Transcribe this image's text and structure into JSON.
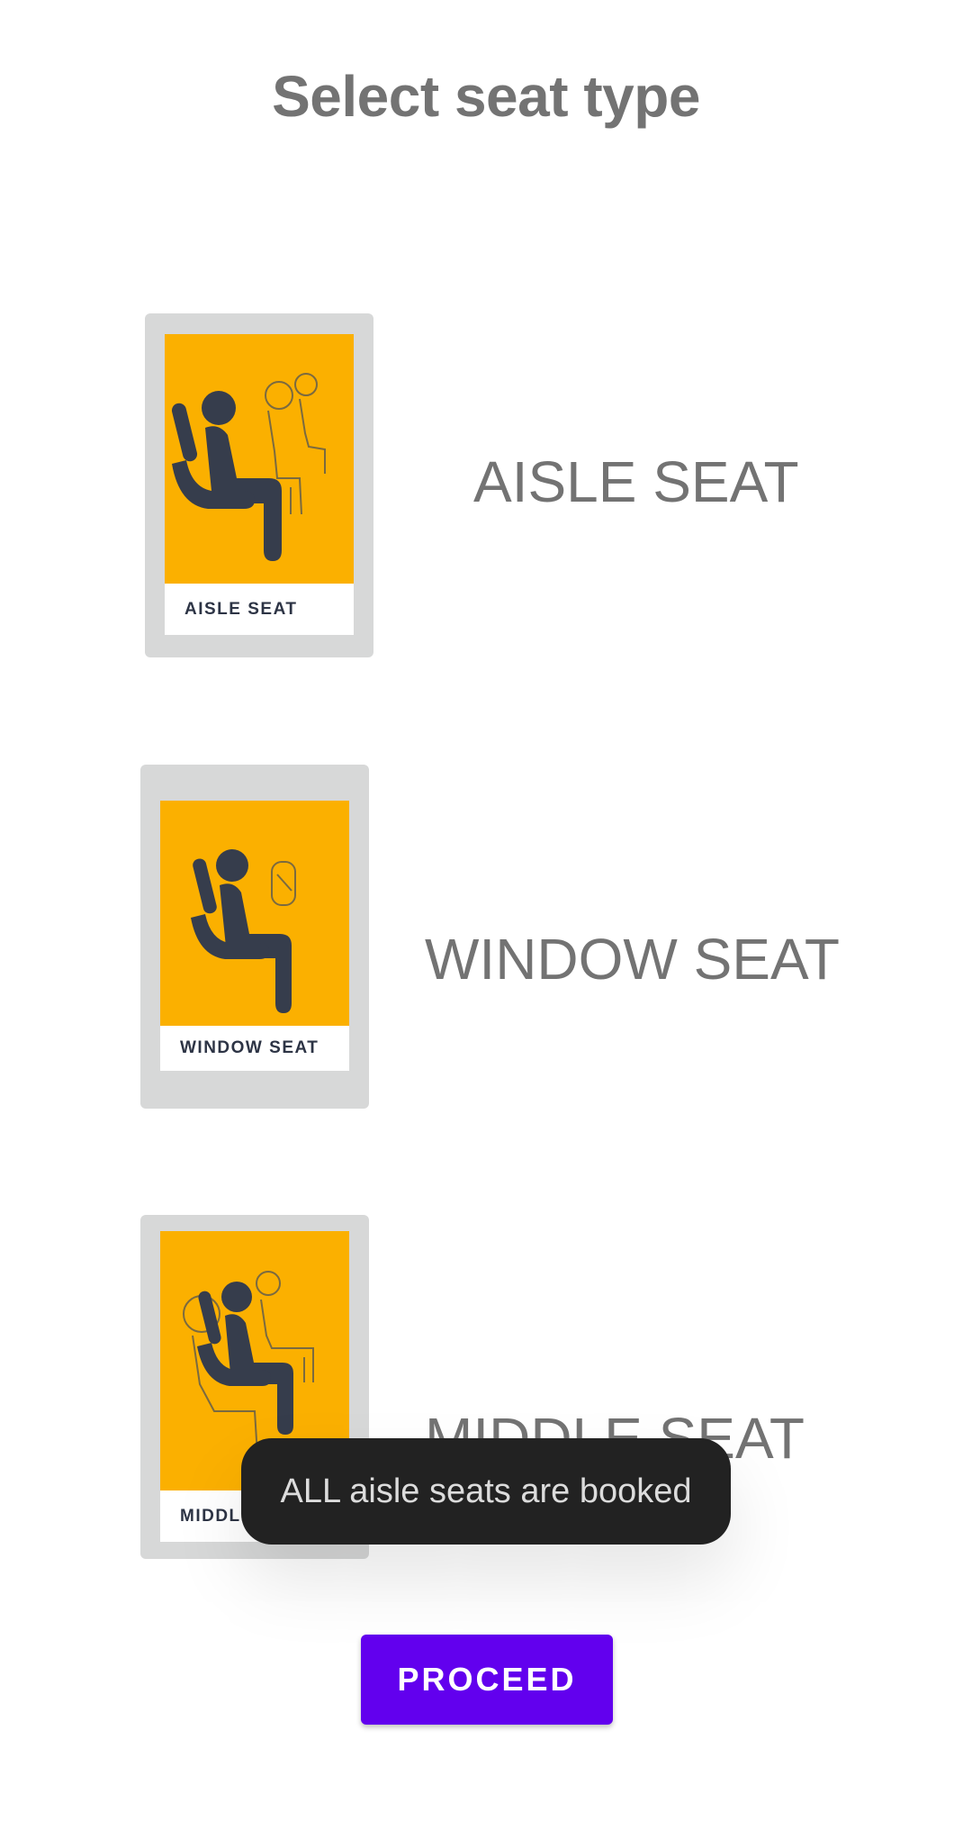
{
  "page": {
    "title": "Select seat type"
  },
  "seats": [
    {
      "name": "AISLE SEAT",
      "poster_label": "AISLE  SEAT"
    },
    {
      "name": "WINDOW SEAT",
      "poster_label": "WINDOW SEAT"
    },
    {
      "name": "MIDDLE SEAT",
      "poster_label": "MIDDLE SEAT"
    }
  ],
  "toast": {
    "message": "ALL aisle seats are booked"
  },
  "actions": {
    "proceed_label": "PROCEED"
  },
  "colors": {
    "accent": "#6200ee",
    "poster_yellow": "#fbb000",
    "card_gray": "#d7d8d8",
    "text_gray": "#737373",
    "toast_bg": "#222222"
  }
}
